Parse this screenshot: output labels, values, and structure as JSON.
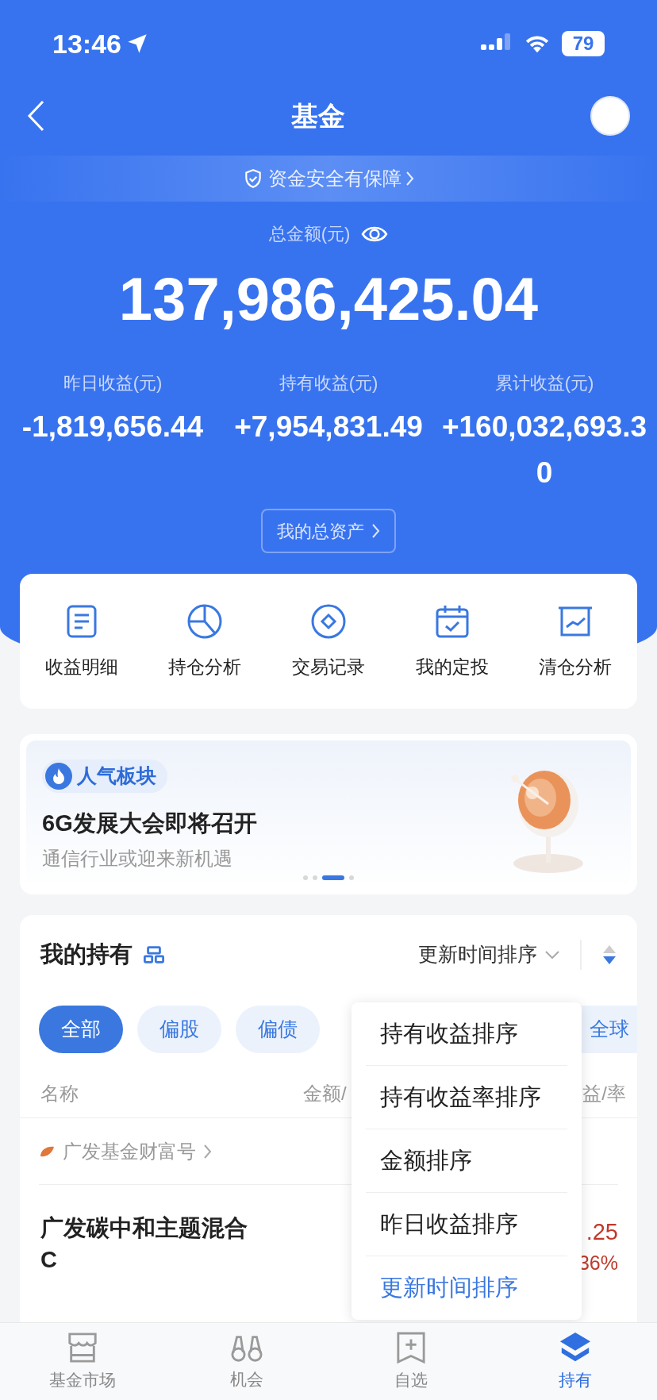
{
  "status_bar": {
    "time": "13:46",
    "battery": "79"
  },
  "nav": {
    "title": "基金"
  },
  "safety_banner": {
    "text": "资金安全有保障"
  },
  "total": {
    "label": "总金额(元)",
    "amount": "137,986,425.04"
  },
  "stats": [
    {
      "label": "昨日收益(元)",
      "value": "-1,819,656.44"
    },
    {
      "label": "持有收益(元)",
      "value": "+7,954,831.49"
    },
    {
      "label": "累计收益(元)",
      "value": "+160,032,693.30"
    }
  ],
  "assets_button": {
    "label": "我的总资产"
  },
  "shortcuts": [
    {
      "kind": "document",
      "label": "收益明细"
    },
    {
      "kind": "pie",
      "label": "持仓分析"
    },
    {
      "kind": "coin",
      "label": "交易记录"
    },
    {
      "kind": "calendar",
      "label": "我的定投"
    },
    {
      "kind": "chart",
      "label": "清仓分析"
    }
  ],
  "promo": {
    "tag": "人气板块",
    "title": "6G发展大会即将召开",
    "subtitle": "通信行业或迎来新机遇",
    "pages": [
      {
        "selected": false
      },
      {
        "selected": false
      },
      {
        "selected": true
      },
      {
        "selected": false
      }
    ]
  },
  "holdings": {
    "title": "我的持有",
    "sort_label": "更新时间排序",
    "chips": [
      {
        "label": "全部",
        "selected": true
      },
      {
        "label": "偏股",
        "selected": false
      },
      {
        "label": "偏债",
        "selected": false
      },
      {
        "label": "全球",
        "selected": false
      }
    ],
    "columns": [
      "名称",
      "金额/",
      "益/率"
    ],
    "group": "广发基金财富号",
    "fund": {
      "name": "广发碳中和主题混合C",
      "value_1": ".25",
      "value_2": "36%"
    }
  },
  "sort_menu": [
    {
      "label": "持有收益排序",
      "selected": false
    },
    {
      "label": "持有收益率排序",
      "selected": false
    },
    {
      "label": "金额排序",
      "selected": false
    },
    {
      "label": "昨日收益排序",
      "selected": false
    },
    {
      "label": "更新时间排序",
      "selected": true
    }
  ],
  "tab_bar": [
    {
      "kind": "store",
      "label": "基金市场",
      "selected": false
    },
    {
      "kind": "binoculars",
      "label": "机会",
      "selected": false
    },
    {
      "kind": "bookmark",
      "label": "自选",
      "selected": false
    },
    {
      "kind": "layers",
      "label": "持有",
      "selected": true
    }
  ]
}
